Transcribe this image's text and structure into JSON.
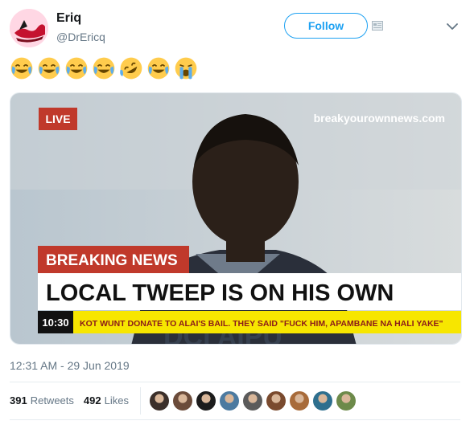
{
  "author": {
    "name": "Eriq",
    "handle": "@DrEricq"
  },
  "header": {
    "follow_label": "Follow"
  },
  "tweet": {
    "emojis": [
      "joy",
      "joy",
      "joy",
      "joy",
      "rofl",
      "joy",
      "sob"
    ]
  },
  "media": {
    "live_label": "LIVE",
    "watermark": "breakyourownnews.com",
    "breaking_label": "BREAKING NEWS",
    "headline": "LOCAL TWEEP IS ON HIS OWN",
    "ticker_time": "10:30",
    "ticker_text": "KOT WUNT DONATE TO ALAI'S BAIL. THEY SAID \"FUCK HIM, APAMBANE NA HALI YAKE\"",
    "background_text": "DCI  AIPU"
  },
  "footer": {
    "timestamp": "12:31 AM - 29 Jun 2019",
    "retweets_count": "391",
    "retweets_label": "Retweets",
    "likes_count": "492",
    "likes_label": "Likes",
    "liker_avatars": [
      "#3b2f2a",
      "#6b4b3a",
      "#1c1c1c",
      "#4c7aa0",
      "#5b5b5b",
      "#7a4a2e",
      "#a86b3a",
      "#2e6f8e",
      "#6d8a4a"
    ]
  },
  "colors": {
    "accent": "#1da1f2",
    "breaking_red": "#c0392b",
    "ticker_yellow": "#f7e600"
  }
}
